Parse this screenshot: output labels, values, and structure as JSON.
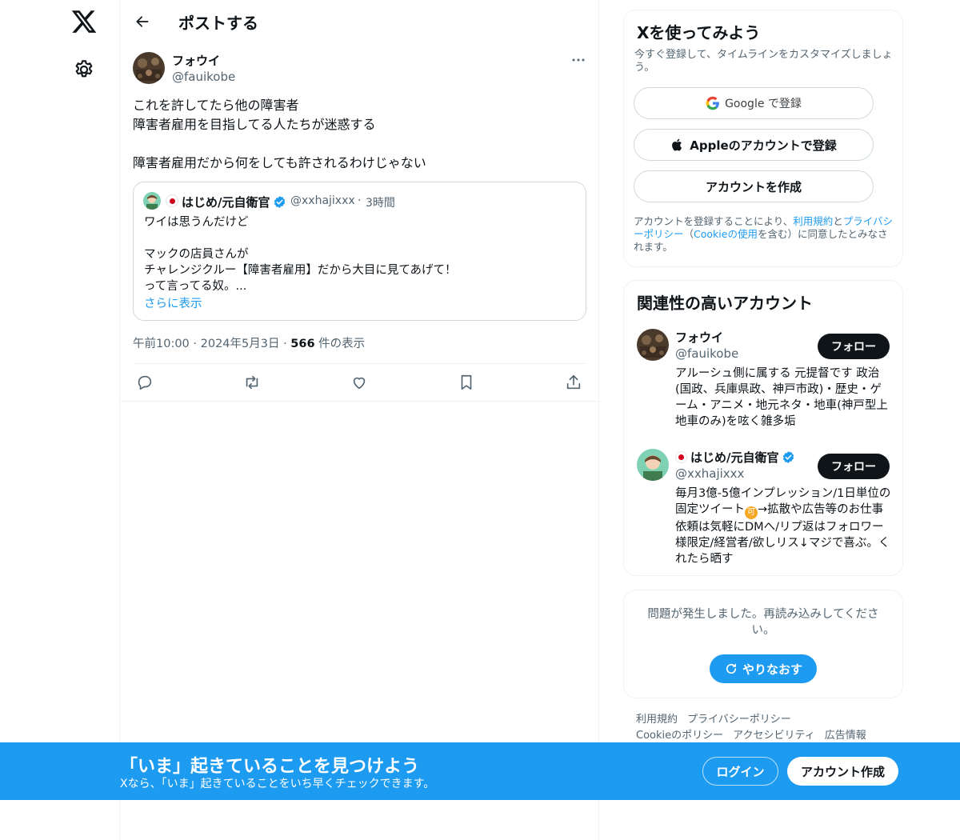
{
  "header": {
    "title": "ポストする"
  },
  "post": {
    "author_name": "フォウイ",
    "author_handle": "@fauikobe",
    "text": "これを許してたら他の障害者\n障害者雇用を目指してる人たちが迷惑する\n\n障害者雇用だから何をしても許されるわけじゃない",
    "quote": {
      "name": "はじめ/元自衛官",
      "handle": "@xxhajixxx",
      "separator": "·",
      "time": "3時間",
      "text": "ワイは思うんだけど\n\nマックの店員さんが\nチャレンジクルー【障害者雇用】だから大目に見てあげて！\nって言ってる奴。...",
      "show_more": "さらに表示"
    },
    "meta_time": "午前10:00 · 2024年5月3日 · ",
    "views_count": "566",
    "views_label": " 件の表示"
  },
  "signup": {
    "title": "Xを使ってみよう",
    "subtitle": "今すぐ登録して、タイムラインをカスタマイズしましょう。",
    "google_label": "Google で登録",
    "apple_label": "Appleのアカウントで登録",
    "create_label": "アカウントを作成",
    "legal_prefix": "アカウントを登録することにより、",
    "legal_terms": "利用規約",
    "legal_and": "と",
    "legal_privacy": "プライバシーポリシー",
    "legal_paren_open": "（",
    "legal_cookie": "Cookieの使用",
    "legal_suffix": "を含む）に同意したとみなされます。"
  },
  "related": {
    "title": "関連性の高いアカウント",
    "accounts": [
      {
        "name": "フォウイ",
        "handle": "@fauikobe",
        "follow_label": "フォロー",
        "bio": "アルーシュ側に属する 元提督です 政治(国政、兵庫県政、神戸市政)・歴史・ゲーム・アニメ・地元ネタ・地車(神戸型上地車のみ)を呟く雑多垢"
      },
      {
        "name": "はじめ/元自衛官",
        "handle": "@xxhajixxx",
        "follow_label": "フォロー",
        "bio_part1": "毎月3億-5億インプレッション/1日単位の固定ツイート",
        "bio_emoji": "可",
        "bio_part2": "→拡散や広告等のお仕事依頼は気軽にDMへ/リプ返はフォロワー様限定/経営者/欲しリス↓マジで喜ぶ。くれたら晒す"
      }
    ]
  },
  "error": {
    "message": "問題が発生しました。再読み込みしてください。",
    "retry_label": "やりなおす"
  },
  "footer": {
    "links": [
      "利用規約",
      "プライバシーポリシー",
      "Cookieのポリシー",
      "アクセシビリティ",
      "広告情報"
    ]
  },
  "banner": {
    "title": "「いま」起きていることを見つけよう",
    "subtitle": "Xなら、「いま」起きていることをいち早くチェックできます。",
    "login_label": "ログイン",
    "signup_label": "アカウント作成"
  },
  "colors": {
    "accent": "#1d9bf0",
    "text": "#0f1419",
    "muted": "#536471",
    "border": "#eff3f4"
  }
}
